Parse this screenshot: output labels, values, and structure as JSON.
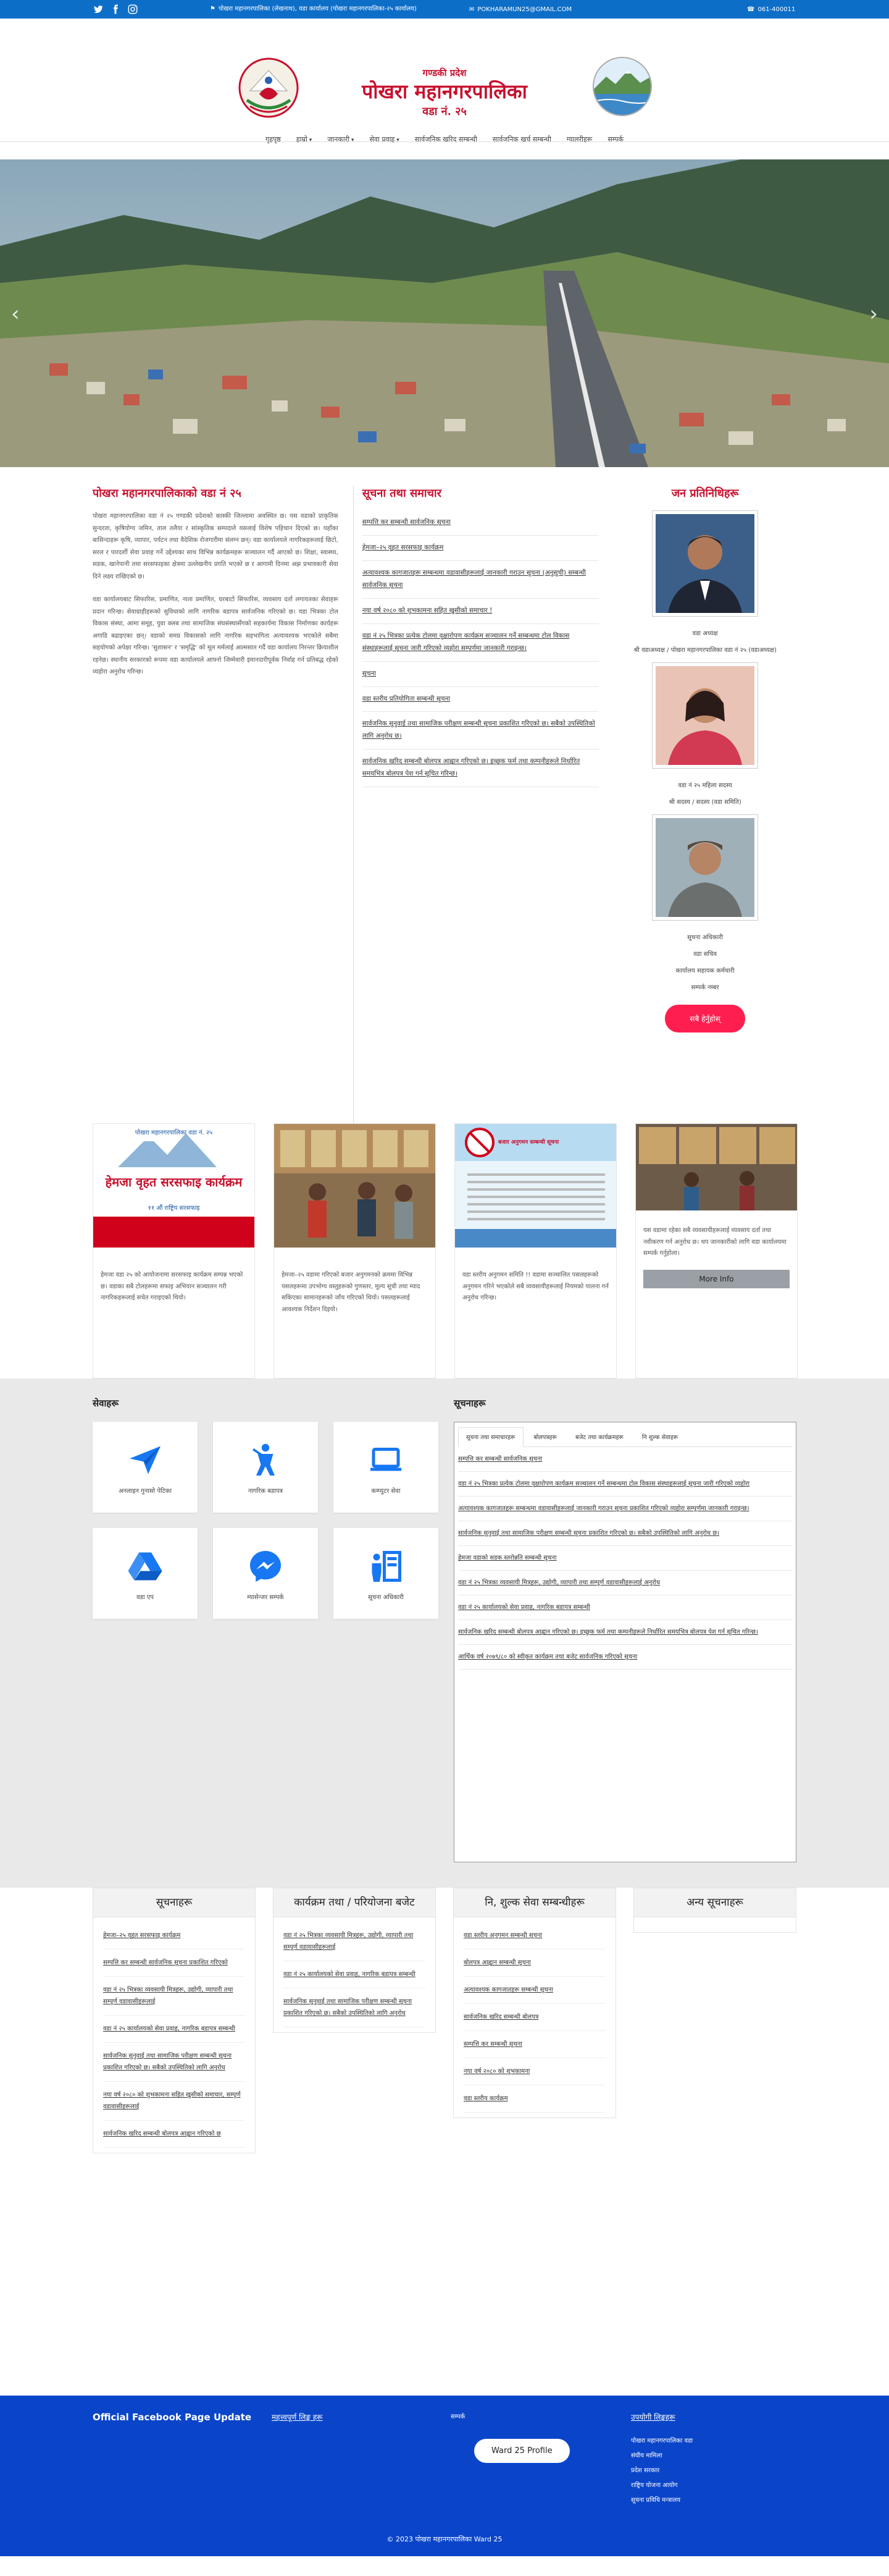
{
  "topbar": {
    "address": "पोखरा महानगरपालिका (लेखनाथ), वडा कार्यालय (पोखरा महानगरपालिका-२५ कार्यालय)",
    "email": "POKHARAMUN25@GMAIL.COM",
    "phone": "061-400011"
  },
  "brand": {
    "province": "गण्डकी प्रदेश",
    "name": "पोखरा महानगरपालिका",
    "ward": "वडा नं. २५"
  },
  "nav": [
    "गृहपृष्ठ",
    "हाम्रो",
    "जानकारी",
    "सेवा प्रवाह",
    "सार्वजनिक खरिद सम्बन्धी",
    "सार्वजनिक खर्च सम्बन्धी",
    "ग्यालरीहरू",
    "सम्पर्क"
  ],
  "about": {
    "title": "पोखरा महानगरपालिकाको वडा नं २५",
    "p1": "पोखरा महानगरपालिका वडा नं २५ गण्डकी प्रदेशको कास्की जिल्लामा अवस्थित छ। यस वडाको प्राकृतिक सुन्दरता, कृषियोग्य जमिन, ताल तलैया र सांस्कृतिक सम्पदाले यसलाई विशेष पहिचान दिएको छ। यहाँका बासिन्दाहरू कृषि, व्यापार, पर्यटन तथा वैदेशिक रोजगारीमा संलग्न छन्। वडा कार्यालयले नागरिकहरूलाई छिटो, सरल र पारदर्शी सेवा प्रवाह गर्ने उद्देश्यका साथ विभिन्न कार्यक्रमहरू सञ्चालन गर्दै आएको छ। शिक्षा, स्वास्थ्य, सडक, खानेपानी तथा सरसफाइका क्षेत्रमा उल्लेखनीय प्रगति भएको छ र आगामी दिनमा अझ प्रभावकारी सेवा दिने लक्ष्य राखिएको छ।",
    "p2": "वडा कार्यालयबाट सिफारिस, प्रमाणित, नाता प्रमाणित, घरबाटो सिफारिस, व्यवसाय दर्ता लगायतका सेवाहरू प्रदान गरिन्छ। सेवाग्राहीहरूको सुविधाको लागि नागरिक बडापत्र सार्वजनिक गरिएको छ। वडा भित्रका टोल विकास संस्था, आमा समूह, युवा क्लब तथा सामाजिक संघसंस्थासँगको सहकार्यमा विकास निर्माणका कार्यहरू अगाडि बढाइएका छन्। वडाको समग्र विकासको लागि नागरिक सहभागिता अत्यावश्यक भएकोले सबैमा सहयोगको अपेक्षा गरिन्छ। 'सुशासन' र 'समृद्धि' को मूल मर्मलाई आत्मसात गर्दै वडा कार्यालय निरन्तर क्रियाशील रहनेछ। स्थानीय सरकारको रूपमा वडा कार्यालयले आफ्नो जिम्मेवारी इमानदारीपूर्वक निर्वाह गर्न प्रतिबद्ध रहेको व्यहोरा अनुरोध गरिन्छ।"
  },
  "notices": {
    "title": "सूचना तथा समाचार",
    "items": [
      "सम्पत्ति कर सम्बन्धी सार्वजनिक सूचना",
      "हेमजा–२५ वृहत सरसफाइ कार्यक्रम",
      "अत्यावश्यक कागजातहरू सम्बन्धमा वडावासीहरूलाई जानकारी गराउन सूचना (अनुसूची) सम्बन्धी सार्वजनिक सूचना",
      "नया वर्ष २०८० को शुभकामना सहित खुसीको समाचार !",
      "वडा नं २५ भित्रका प्रत्येक टोलमा वृक्षारोपण कार्यक्रम सञ्चालन गर्ने सम्बन्धमा टोल विकास संस्थाहरूलाई सूचना जारी गरिएको व्यहोरा सम्पूर्णमा जानकारी गराइन्छ।",
      "सूचना",
      "वडा स्तरीय प्रतियोगिता सम्बन्धी सूचना",
      "सार्वजनिक सुनुवाई तथा सामाजिक परीक्षण सम्बन्धी सूचना प्रकाशित गरिएको छ। सबैको उपस्थितिको लागि अनुरोध छ।",
      "सार्वजनिक खरिद सम्बन्धी बोलपत्र आह्वान गरिएको छ। इच्छुक फर्म तथा कम्पनीहरूले निर्धारित समयभित्र बोलपत्र पेश गर्न सूचित गरिन्छ।"
    ]
  },
  "staff": {
    "title": "जन प्रतिनिधिहरू",
    "people": [
      {
        "name": "वडा अध्यक्ष",
        "role": "श्री वडाअध्यक्ष / पोखरा महानगरपालिका वडा नं २५ (वडाअध्यक्ष)"
      },
      {
        "name": "वडा नं २५ महिला सदस्य",
        "role": "श्री सदस्य / सदस्य (वडा समिति)"
      },
      {
        "name": "सूचना अधिकारी",
        "role": "वडा सचिव",
        "extra1": "कार्यालय सहायक कर्मचारी",
        "extra2": "सम्पर्क नम्बर"
      }
    ],
    "button": "सबै हेर्नुहोस्"
  },
  "cards": [
    {
      "poster_title": "हेमजा वृहत सरसफाइ कार्यक्रम",
      "poster_org": "पोखरा महानगरपालिका वडा नं. २५",
      "poster_date": "११ औं राष्ट्रिय सरसफाइ",
      "text": "हेमजा वडा २५ को आयोजनामा सरसफाइ कार्यक्रम सम्पन्न भएको छ। वडाका सबै टोलहरूमा सफाइ अभियान सञ्चालन गरी नागरिकहरूलाई सचेत गराइएको थियो।"
    },
    {
      "text": "हेमजा–२५ वडामा गरिएको बजार अनुगमनको क्रममा विभिन्न पसलहरूमा उपभोग्य वस्तुहरूको गुणस्तर, मूल्य सूची तथा म्याद सकिएका सामानहरूको जाँच गरिएको थियो। पसलहरूलाई आवश्यक निर्देशन दिइयो।"
    },
    {
      "poster_title": "बजार अनुगमन सम्बन्धी सूचना",
      "text": "वडा स्तरीय अनुगमन समिति !! वडामा सञ्चालित पसलहरूको अनुगमन गरिने भएकोले सबै व्यवसायीहरूलाई नियमको पालना गर्न अनुरोध गरिन्छ।"
    },
    {
      "text": "यस वडामा रहेका सबै व्यवसायीहरूलाई व्यवसाय दर्ता तथा नवीकरण गर्न अनुरोध छ। थप जानकारीको लागि वडा कार्यालयमा सम्पर्क गर्नुहोला।",
      "more": "More Info"
    }
  ],
  "services": {
    "title": "सेवाहरू",
    "items": [
      "अनलाइन गुनासो पेटिका",
      "नागरिक बडापत्र",
      "कम्प्युटर सेवा",
      "वडा एप",
      "म्यासेन्जर सम्पर्क",
      "सूचना अधिकारी"
    ]
  },
  "tabs": {
    "title": "सूचनाहरू",
    "labels": [
      "सूचना तथा समाचारहरू",
      "बोलपत्रहरू",
      "बजेट तथा कार्यक्रमहरू",
      "नि शुल्क सेवाहरू"
    ],
    "items": [
      "सम्पत्ति कर सम्बन्धी सार्वजनिक सूचना",
      "वडा नं २५ भित्रका प्रत्येक टोलमा वृक्षारोपण कार्यक्रम सञ्चालन गर्ने सम्बन्धमा टोल विकास संस्थाहरूलाई सूचना जारी गरिएको व्यहोरा",
      "अत्यावश्यक कागजातहरू सम्बन्धमा वडावासीहरूलाई जानकारी गराउन सूचना प्रकाशित गरिएको व्यहोरा सम्पूर्णमा जानकारी गराइन्छ।",
      "सार्वजनिक सुनुवाई तथा सामाजिक परीक्षण सम्बन्धी सूचना प्रकाशित गरिएको छ। सबैको उपस्थितिको लागि अनुरोध छ।",
      "हेमजा वडाको सडक स्तरोन्नति सम्बन्धी सूचना",
      "वडा नं २५ भित्रका व्यवसायी मित्रहरू, उद्योगी, व्यापारी तथा सम्पूर्ण वडावासीहरूलाई अनुरोध",
      "वडा नं २५ कार्यालयको सेवा प्रवाह, नागरिक बडापत्र सम्बन्धी",
      "सार्वजनिक खरिद सम्बन्धी बोलपत्र आह्वान गरिएको छ। इच्छुक फर्म तथा कम्पनीहरूले निर्धारित समयभित्र बोलपत्र पेश गर्न सूचित गरिन्छ।",
      "आर्थिक वर्ष २०७९/८० को स्वीकृत कार्यक्रम तथा बजेट सार्वजनिक गरिएको सूचना"
    ]
  },
  "lists": [
    {
      "title": "सूचनाहरू",
      "items": [
        "हेमजा–२५ वृहत सरसफाइ कार्यक्रम",
        "सम्पत्ति कर सम्बन्धी सार्वजनिक सूचना प्रकाशित गरिएको",
        "वडा नं २५ भित्रका व्यवसायी मित्रहरू, उद्योगी, व्यापारी तथा सम्पूर्ण वडावासीहरूलाई",
        "वडा नं २५ कार्यालयको सेवा प्रवाह, नागरिक बडापत्र सम्बन्धी",
        "सार्वजनिक सुनुवाई तथा सामाजिक परीक्षण सम्बन्धी सूचना प्रकाशित गरिएको छ। सबैको उपस्थितिको लागि अनुरोध",
        "नया वर्ष २०८० को शुभकामना सहित खुसीको समाचार, सम्पूर्ण वडावासीहरूलाई",
        "सार्वजनिक खरिद सम्बन्धी बोलपत्र आह्वान गरिएको छ"
      ]
    },
    {
      "title": "कार्यक्रम तथा / परियोजना बजेट",
      "items": [
        "वडा नं २५ भित्रका व्यवसायी मित्रहरू, उद्योगी, व्यापारी तथा सम्पूर्ण वडावासीहरूलाई",
        "वडा नं २५ कार्यालयको सेवा प्रवाह, नागरिक बडापत्र सम्बन्धी",
        "सार्वजनिक सुनुवाई तथा सामाजिक परीक्षण सम्बन्धी सूचना प्रकाशित गरिएको छ। सबैको उपस्थितिको लागि अनुरोध"
      ]
    },
    {
      "title": "नि, शुल्क सेवा सम्बन्धीहरू",
      "items": [
        "वडा स्तरीय अनुगमन सम्बन्धी सूचना",
        "बोलपत्र आह्वान सम्बन्धी सूचना",
        "अत्यावश्यक कागजातहरू सम्बन्धी सूचना",
        "सार्वजनिक खरिद सम्बन्धी बोलपत्र",
        "सम्पत्ति कर सम्बन्धी सूचना",
        "नया वर्ष २०८० को शुभकामना",
        "वडा स्तरीय कार्यक्रम"
      ]
    },
    {
      "title": "अन्य सूचनाहरू",
      "items": []
    }
  ],
  "footer": {
    "fb_title": "Official Facebook Page Update",
    "col2": "महत्त्वपूर्ण लिङ्क हरू",
    "col3": "सम्पर्क",
    "profile_btn": "Ward 25 Profile",
    "col4_title": "उपयोगी लिङ्कहरू",
    "col4_links": [
      "पोखरा महानगरपालिका वडा",
      "संघीय मामिला",
      "प्रदेश सरकार",
      "राष्ट्रिय योजना आयोग",
      "सूचना प्रविधि मन्त्रालय"
    ],
    "copyright": "© 2023 पोखरा महानगरपालिका Ward 25"
  }
}
